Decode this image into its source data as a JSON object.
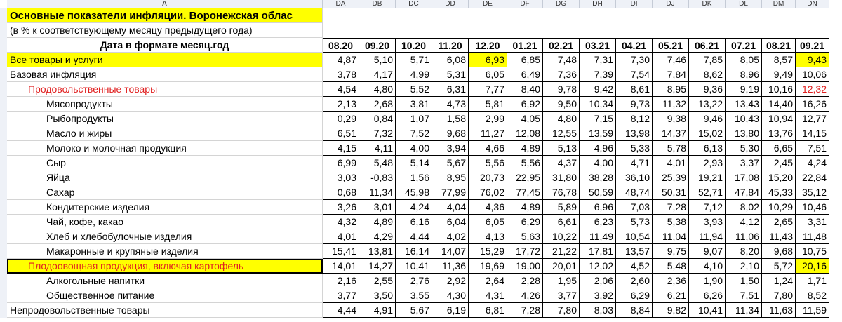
{
  "columns": {
    "label_col": "A",
    "data_cols": [
      "DA",
      "DB",
      "DC",
      "DD",
      "DE",
      "DF",
      "DG",
      "DH",
      "DI",
      "DJ",
      "DK",
      "DL",
      "DM",
      "DN"
    ]
  },
  "row_numbers": [
    "",
    "",
    "",
    "",
    "",
    "",
    "",
    "",
    "",
    "",
    "",
    "",
    "",
    "",
    "",
    "",
    "",
    "",
    "",
    "",
    "",
    ""
  ],
  "title": "Основные показатели инфляции. Воронежская облас",
  "subtitle": "(в % к соответствующему месяцу предыдущего года)",
  "date_header_label": "Дата в формате месяц.год",
  "dates": [
    "08.20",
    "09.20",
    "10.20",
    "11.20",
    "12.20",
    "01.21",
    "02.21",
    "03.21",
    "04.21",
    "05.21",
    "06.21",
    "07.21",
    "08.21",
    "09.21"
  ],
  "rows": [
    {
      "rn": "",
      "label": "Все товары и услуги",
      "values": [
        "4,87",
        "5,10",
        "5,71",
        "6,08",
        "6,93",
        "6,85",
        "7,48",
        "7,31",
        "7,30",
        "7,46",
        "7,85",
        "8,05",
        "8,57",
        "9,43"
      ]
    },
    {
      "rn": "",
      "label": "Базовая инфляция",
      "values": [
        "3,78",
        "4,17",
        "4,99",
        "5,31",
        "6,05",
        "6,49",
        "7,36",
        "7,39",
        "7,54",
        "7,84",
        "8,62",
        "8,96",
        "9,49",
        "10,06"
      ]
    },
    {
      "rn": "",
      "label": "Продовольственные товары",
      "values": [
        "4,54",
        "4,80",
        "5,52",
        "6,31",
        "7,77",
        "8,40",
        "9,78",
        "9,42",
        "8,61",
        "8,95",
        "9,36",
        "9,19",
        "10,16",
        "12,32"
      ]
    },
    {
      "rn": "",
      "label": "Мясопродукты",
      "values": [
        "2,13",
        "2,68",
        "3,81",
        "4,73",
        "5,81",
        "6,92",
        "9,50",
        "10,34",
        "9,73",
        "11,32",
        "13,22",
        "13,43",
        "14,40",
        "16,26"
      ]
    },
    {
      "rn": "",
      "label": "Рыбопродукты",
      "values": [
        "0,29",
        "0,84",
        "1,07",
        "1,58",
        "2,99",
        "4,05",
        "4,80",
        "7,15",
        "8,12",
        "9,38",
        "9,46",
        "10,43",
        "10,94",
        "12,77"
      ]
    },
    {
      "rn": "",
      "label": "Масло и жиры",
      "values": [
        "6,51",
        "7,32",
        "7,52",
        "9,68",
        "11,27",
        "12,08",
        "12,55",
        "13,59",
        "13,98",
        "14,37",
        "15,02",
        "13,80",
        "13,76",
        "14,15"
      ]
    },
    {
      "rn": "",
      "label": "Молоко и молочная продукция",
      "values": [
        "4,15",
        "4,11",
        "4,00",
        "3,94",
        "4,66",
        "4,89",
        "5,13",
        "4,96",
        "5,33",
        "5,78",
        "6,13",
        "5,30",
        "6,65",
        "7,51"
      ]
    },
    {
      "rn": "",
      "label": "Сыр",
      "values": [
        "6,99",
        "5,48",
        "5,14",
        "5,67",
        "5,56",
        "5,56",
        "4,37",
        "4,00",
        "4,71",
        "4,01",
        "2,93",
        "3,37",
        "2,45",
        "4,24"
      ]
    },
    {
      "rn": "",
      "label": "Яйца",
      "values": [
        "3,03",
        "-0,83",
        "1,56",
        "8,95",
        "20,73",
        "22,95",
        "31,80",
        "38,28",
        "36,10",
        "25,39",
        "19,21",
        "17,08",
        "15,20",
        "22,84"
      ]
    },
    {
      "rn": "",
      "label": "Сахар",
      "values": [
        "0,68",
        "11,34",
        "45,98",
        "77,99",
        "76,02",
        "77,45",
        "76,78",
        "50,59",
        "48,74",
        "50,31",
        "52,71",
        "47,84",
        "45,33",
        "35,12"
      ]
    },
    {
      "rn": "",
      "label": "Кондитерские изделия",
      "values": [
        "3,26",
        "3,01",
        "4,24",
        "4,04",
        "4,36",
        "4,89",
        "5,89",
        "6,96",
        "7,03",
        "7,28",
        "7,12",
        "8,02",
        "10,29",
        "10,46"
      ]
    },
    {
      "rn": "",
      "label": "Чай, кофе, какао",
      "values": [
        "4,32",
        "4,89",
        "6,16",
        "6,04",
        "6,05",
        "6,29",
        "6,61",
        "6,23",
        "5,73",
        "5,38",
        "3,93",
        "4,12",
        "2,65",
        "3,31"
      ]
    },
    {
      "rn": "",
      "label": "Хлеб и хлебобулочные изделия",
      "values": [
        "4,01",
        "4,29",
        "4,44",
        "4,02",
        "4,13",
        "5,63",
        "10,22",
        "11,49",
        "10,54",
        "11,04",
        "11,94",
        "11,06",
        "11,43",
        "11,48"
      ]
    },
    {
      "rn": "",
      "label": "Макаронные и крупяные изделия",
      "values": [
        "15,41",
        "13,81",
        "16,14",
        "14,07",
        "15,29",
        "17,72",
        "21,22",
        "17,81",
        "13,57",
        "9,75",
        "9,07",
        "8,20",
        "9,68",
        "10,75"
      ]
    },
    {
      "rn": "",
      "label": "Плодоовощная продукция, включая картофель",
      "values": [
        "14,01",
        "14,27",
        "10,41",
        "11,36",
        "19,69",
        "19,00",
        "20,01",
        "12,02",
        "4,52",
        "5,48",
        "4,10",
        "2,10",
        "5,72",
        "20,16"
      ]
    },
    {
      "rn": "",
      "label": "Алкогольные напитки",
      "values": [
        "2,16",
        "2,55",
        "2,76",
        "2,92",
        "2,64",
        "2,28",
        "1,95",
        "2,06",
        "2,60",
        "2,36",
        "1,90",
        "1,50",
        "1,24",
        "1,71"
      ]
    },
    {
      "rn": "",
      "label": "Общественное питание",
      "values": [
        "3,77",
        "3,50",
        "3,55",
        "4,30",
        "4,31",
        "4,26",
        "3,77",
        "3,92",
        "6,29",
        "6,21",
        "6,26",
        "7,51",
        "7,80",
        "8,52"
      ]
    },
    {
      "rn": "",
      "label": "Непродовольственные товары",
      "values": [
        "4,44",
        "4,91",
        "5,67",
        "6,19",
        "6,81",
        "7,28",
        "7,80",
        "8,03",
        "8,84",
        "9,82",
        "10,41",
        "11,34",
        "11,63",
        "11,59"
      ]
    }
  ],
  "colors": {
    "highlight": "#ffff00",
    "red_text": "#e02020"
  }
}
